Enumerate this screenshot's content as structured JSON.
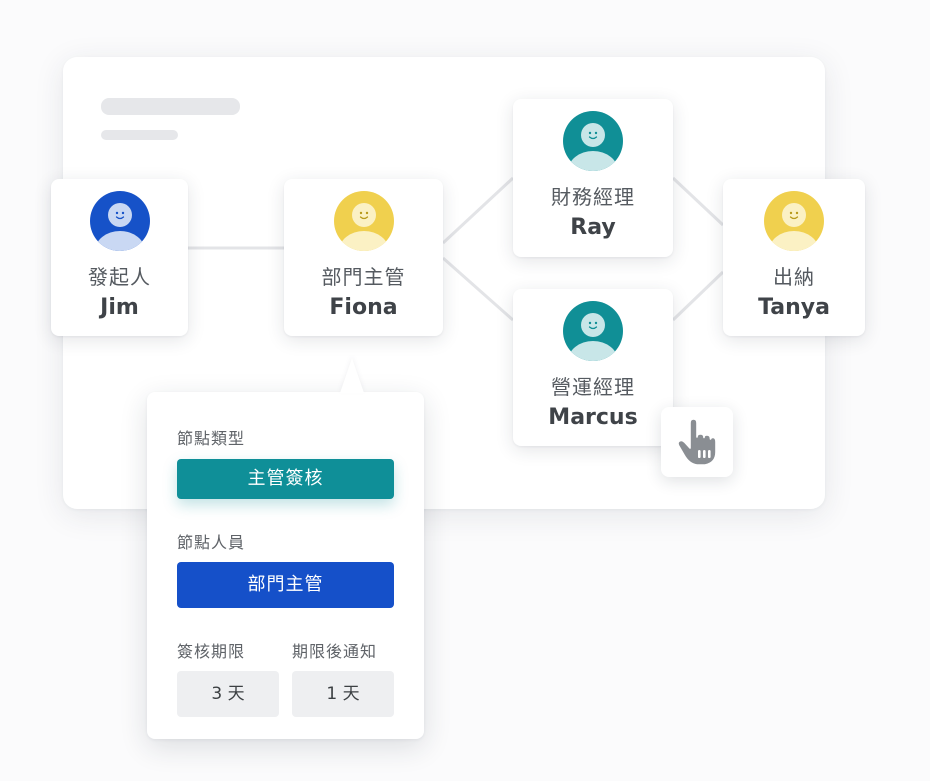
{
  "nodes": {
    "initiator": {
      "role": "發起人",
      "name": "Jim"
    },
    "dept_head": {
      "role": "部門主管",
      "name": "Fiona"
    },
    "finance_manager": {
      "role": "財務經理",
      "name": "Ray"
    },
    "ops_manager": {
      "role": "營運經理",
      "name": "Marcus"
    },
    "cashier": {
      "role": "出納",
      "name": "Tanya"
    }
  },
  "popover": {
    "node_type_label": "節點類型",
    "node_type_value": "主管簽核",
    "node_members_label": "節點人員",
    "node_members_value": "部門主管",
    "deadline_label": "簽核期限",
    "notify_label": "期限後通知",
    "deadline_value": "3 天",
    "notify_value": "1 天"
  },
  "colors": {
    "blue": "#1550c9",
    "teal": "#0f8f98",
    "yellow": "#f0d04e"
  },
  "icons": [
    "avatar-icon",
    "hand-pointer-icon"
  ]
}
